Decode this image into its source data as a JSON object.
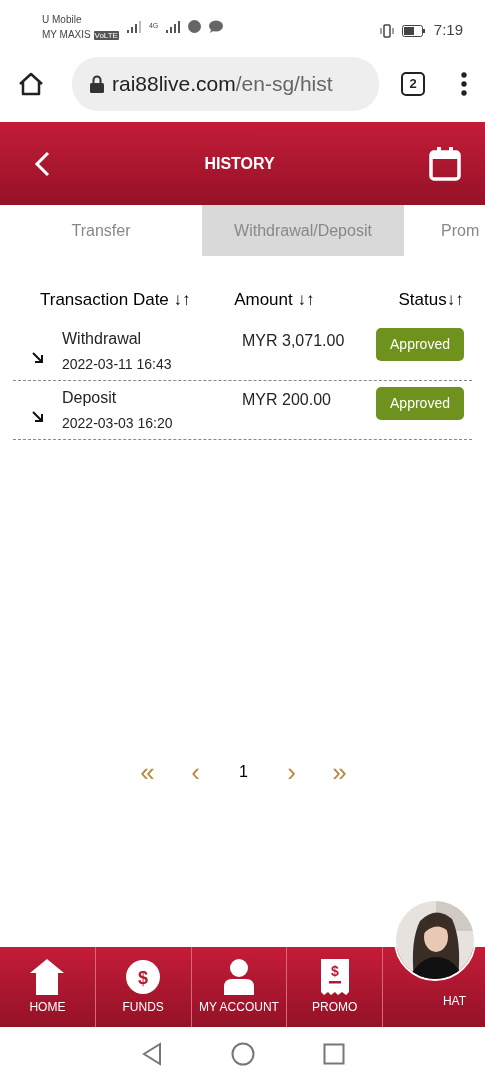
{
  "status_bar": {
    "carrier_1": "U Mobile",
    "carrier_2": "MY MAXIS",
    "volte": "VoLTE",
    "network": "4G",
    "time": "7:19"
  },
  "browser": {
    "url_host": "rai88live.com",
    "url_path": "/en-sg/hist",
    "tab_count": "2"
  },
  "header": {
    "title": "HISTORY"
  },
  "tabs": [
    {
      "label": "Transfer",
      "selected": false
    },
    {
      "label": "Withdrawal/Deposit",
      "selected": true
    },
    {
      "label": "Prom",
      "selected": false
    }
  ],
  "columns": [
    {
      "label": "Transaction Date",
      "sort": "↓↑"
    },
    {
      "label": "Amount",
      "sort": "↓↑"
    },
    {
      "label": "Status",
      "sort": "↓↑"
    }
  ],
  "rows": [
    {
      "type": "Withdrawal",
      "date": "2022-03-11 16:43",
      "amount": "MYR 3,071.00",
      "status": "Approved",
      "color": "#6f921e"
    },
    {
      "type": "Deposit",
      "date": "2022-03-03 16:20",
      "amount": "MYR 200.00",
      "status": "Approved",
      "color": "#6f921e"
    }
  ],
  "pagination": {
    "first": "«",
    "prev": "‹",
    "page": "1",
    "next": "›",
    "last": "»"
  },
  "bottom_nav": [
    {
      "kind": "home",
      "label": "HOME"
    },
    {
      "kind": "funds",
      "label": "FUNDS",
      "icon_text": "$"
    },
    {
      "kind": "account",
      "label": "MY ACCOUNT"
    },
    {
      "kind": "promo",
      "label": "PROMO",
      "icon_text": "$"
    },
    {
      "kind": "chat",
      "label": "HAT"
    }
  ]
}
